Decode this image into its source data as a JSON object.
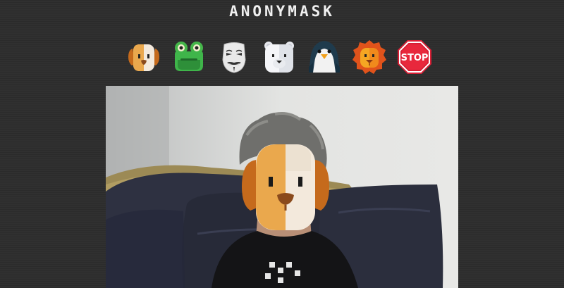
{
  "app": {
    "title": "ANONYMASK"
  },
  "mask_buttons": [
    {
      "id": "dog",
      "icon": "dog-icon"
    },
    {
      "id": "frog",
      "icon": "frog-icon"
    },
    {
      "id": "guy-fawkes",
      "icon": "guy-fawkes-mask-icon"
    },
    {
      "id": "polar-bear",
      "icon": "polar-bear-icon"
    },
    {
      "id": "penguin",
      "icon": "penguin-icon"
    },
    {
      "id": "lion",
      "icon": "lion-icon"
    },
    {
      "id": "stop",
      "icon": "stop-sign-icon",
      "label": "STOP"
    }
  ],
  "active_mask": "dog",
  "colors": {
    "background": "#303030",
    "title": "#f0f0f0",
    "stop_red": "#e8283c",
    "dog_orange": "#e9a24a",
    "frog_green": "#3fb54a",
    "lion_orange": "#f07a1a"
  }
}
